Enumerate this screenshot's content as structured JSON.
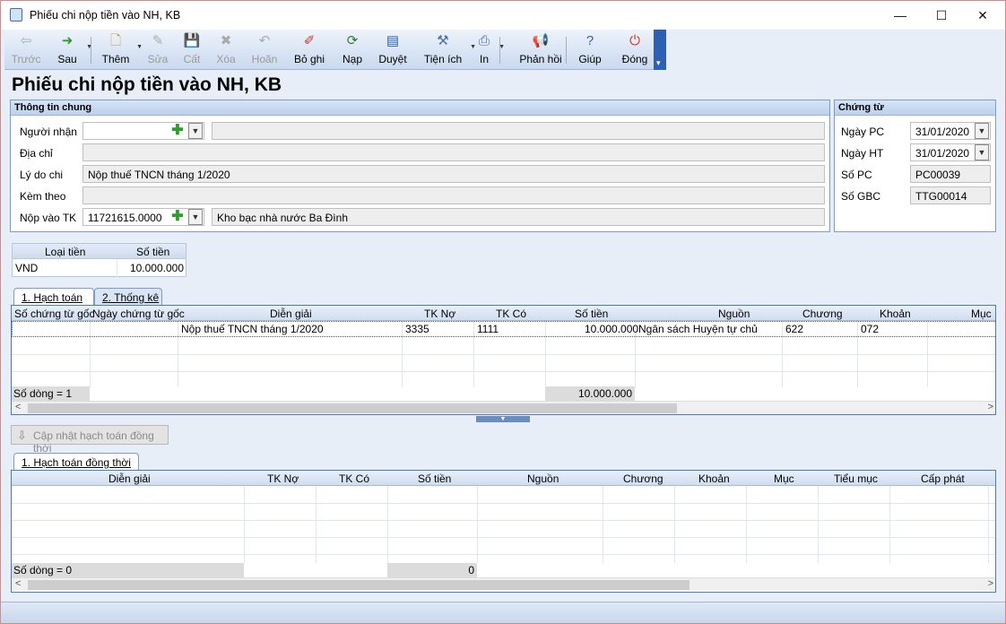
{
  "window": {
    "title": "Phiếu chi nộp tiền vào NH, KB",
    "minimize": "—",
    "maximize": "☐",
    "close": "✕"
  },
  "toolbar": {
    "items": [
      {
        "label": "Trước",
        "icon": "arrow-left-icon",
        "glyph": "⇦",
        "disabled": true
      },
      {
        "label": "Sau",
        "icon": "arrow-right-icon",
        "glyph": "➜",
        "disabled": false
      },
      {
        "label": "Thêm",
        "icon": "add-document-icon",
        "glyph": "🗋",
        "disabled": false
      },
      {
        "label": "Sửa",
        "icon": "edit-icon",
        "glyph": "✎",
        "disabled": true
      },
      {
        "label": "Cất",
        "icon": "save-icon",
        "glyph": "💾",
        "disabled": true
      },
      {
        "label": "Xóa",
        "icon": "delete-icon",
        "glyph": "✖",
        "disabled": true
      },
      {
        "label": "Hoãn",
        "icon": "undo-icon",
        "glyph": "↶",
        "disabled": true
      },
      {
        "label": "Bỏ ghi",
        "icon": "unpost-icon",
        "glyph": "✐",
        "disabled": false
      },
      {
        "label": "Nạp",
        "icon": "reload-icon",
        "glyph": "⟳",
        "disabled": false
      },
      {
        "label": "Duyệt",
        "icon": "browse-icon",
        "glyph": "▤",
        "disabled": false
      },
      {
        "label": "Tiện ích",
        "icon": "tools-icon",
        "glyph": "⚒",
        "disabled": false
      },
      {
        "label": "In",
        "icon": "print-icon",
        "glyph": "⎙",
        "disabled": false
      },
      {
        "label": "Phản hồi",
        "icon": "feedback-icon",
        "glyph": "📢",
        "disabled": false
      },
      {
        "label": "Giúp",
        "icon": "help-icon",
        "glyph": "?",
        "disabled": false
      },
      {
        "label": "Đóng",
        "icon": "power-icon",
        "glyph": "⏻",
        "disabled": false
      }
    ]
  },
  "page_title": "Phiếu chi nộp tiền vào NH, KB",
  "general": {
    "header": "Thông tin chung",
    "nguoi_nhan_label": "Người nhận",
    "nguoi_nhan_code": "",
    "nguoi_nhan_name": "",
    "dia_chi_label": "Địa chỉ",
    "dia_chi": "",
    "ly_do_chi_label": "Lý do chi",
    "ly_do_chi": "Nộp thuế TNCN tháng 1/2020",
    "kem_theo_label": "Kèm theo",
    "kem_theo": "",
    "nop_vao_tk_label": "Nộp vào TK",
    "nop_vao_tk": "11721615.0000",
    "nop_vao_tk_name": "Kho bạc nhà nước Ba Đình"
  },
  "voucher": {
    "header": "Chứng từ",
    "ngay_pc_label": "Ngày PC",
    "ngay_pc": "31/01/2020",
    "ngay_ht_label": "Ngày HT",
    "ngay_ht": "31/01/2020",
    "so_pc_label": "Số PC",
    "so_pc": "PC00039",
    "so_gbc_label": "Số GBC",
    "so_gbc": "TTG00014"
  },
  "currency_table": {
    "col_loai_tien": "Loại tiền",
    "col_so_tien": "Số tiền",
    "loai_tien": "VND",
    "so_tien": "10.000.000"
  },
  "tabs_top": [
    {
      "label": "1. Hạch toán"
    },
    {
      "label": "2. Thống kê"
    }
  ],
  "grid1": {
    "columns": [
      "Số chứng từ gốc",
      "Ngày chứng từ gốc",
      "Diễn giải",
      "TK Nợ",
      "TK Có",
      "Số tiền",
      "Nguồn",
      "Chương",
      "Khoản",
      "Mục"
    ],
    "row": {
      "so_ct_goc": "",
      "ngay_ct_goc": "",
      "dien_giai": "Nộp thuế TNCN tháng 1/2020",
      "tk_no": "3335",
      "tk_co": "1111",
      "so_tien": "10.000.000",
      "nguon": "Ngân sách Huyện tự chủ",
      "chuong": "622",
      "khoan": "072",
      "muc": ""
    },
    "footer_count": "Số dòng = 1",
    "footer_total": "10.000.000"
  },
  "update_button": "Cập nhật hạch toán đồng thời",
  "tabs_bottom": [
    {
      "label": "1. Hạch toán đồng thời"
    }
  ],
  "grid2": {
    "columns": [
      "Diễn giải",
      "TK Nợ",
      "TK Có",
      "Số tiền",
      "Nguồn",
      "Chương",
      "Khoản",
      "Mục",
      "Tiểu mục",
      "Cấp phát"
    ],
    "footer_count": "Số dòng = 0",
    "footer_total": "0"
  }
}
